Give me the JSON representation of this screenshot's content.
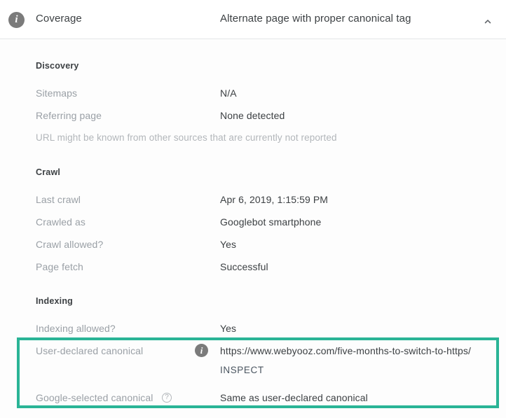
{
  "header": {
    "info_icon": "info-icon",
    "title": "Coverage",
    "status": "Alternate page with proper canonical tag",
    "collapse_icon": "chevron-up-icon"
  },
  "sections": [
    {
      "id": "discovery",
      "title": "Discovery",
      "rows": [
        {
          "label": "Sitemaps",
          "value": "N/A"
        },
        {
          "label": "Referring page",
          "value": "None detected"
        }
      ],
      "note": "URL might be known from other sources that are currently not reported"
    },
    {
      "id": "crawl",
      "title": "Crawl",
      "rows": [
        {
          "label": "Last crawl",
          "value": "Apr 6, 2019, 1:15:59 PM"
        },
        {
          "label": "Crawled as",
          "value": "Googlebot smartphone"
        },
        {
          "label": "Crawl allowed?",
          "value": "Yes"
        },
        {
          "label": "Page fetch",
          "value": "Successful"
        }
      ]
    },
    {
      "id": "indexing",
      "title": "Indexing",
      "rows": [
        {
          "label": "Indexing allowed?",
          "value": "Yes"
        },
        {
          "label": "User-declared canonical",
          "value": "https://www.webyooz.com/five-months-to-switch-to-https/",
          "info_icon": "info-icon",
          "action_label": "INSPECT"
        },
        {
          "label": "Google-selected canonical",
          "value": "Same as user-declared canonical",
          "help_icon": "help-icon"
        }
      ]
    }
  ],
  "highlight": {
    "color": "#2ab496",
    "name": "canonical-highlight"
  },
  "glyphs": {
    "info": "i",
    "help": "?"
  }
}
